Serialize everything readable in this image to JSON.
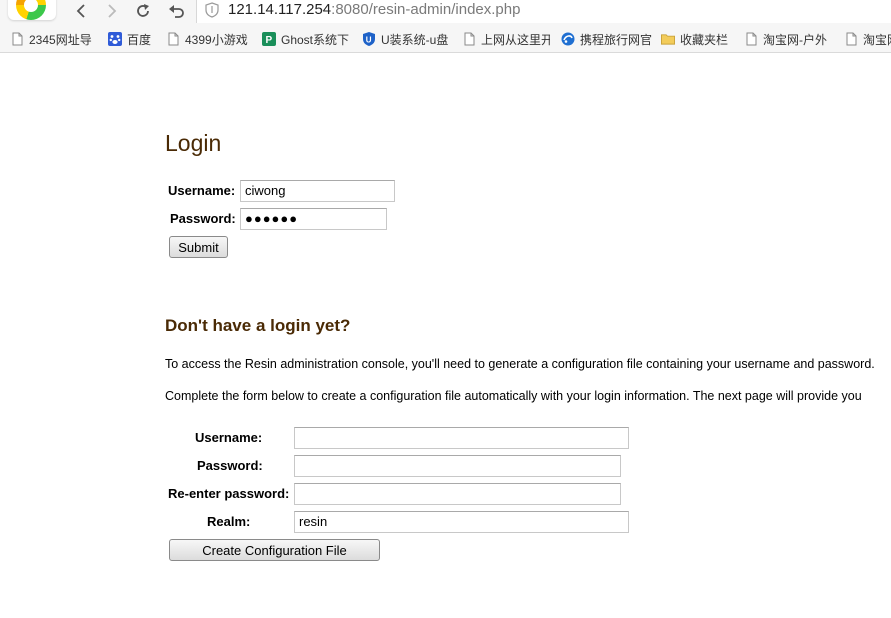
{
  "browser": {
    "url_host": "121.14.117.254",
    "url_rest": ":8080/resin-admin/index.php",
    "bookmarks": [
      {
        "label": "2345网址导",
        "icon": "page-icon"
      },
      {
        "label": "百度",
        "icon": "baidu-paw-icon"
      },
      {
        "label": "4399小游戏",
        "icon": "page-icon"
      },
      {
        "label": "Ghost系统下",
        "icon": "ghost-p-icon"
      },
      {
        "label": "U装系统-u盘",
        "icon": "u-shield-icon"
      },
      {
        "label": "上网从这里开",
        "icon": "page-icon"
      },
      {
        "label": "携程旅行网官",
        "icon": "ctrip-icon"
      },
      {
        "label": "收藏夹栏",
        "icon": "folder-icon"
      },
      {
        "label": "淘宝网-户外",
        "icon": "page-icon"
      },
      {
        "label": "淘宝网",
        "icon": "page-icon"
      }
    ]
  },
  "login": {
    "title": "Login",
    "username_label": "Username:",
    "username_value": "ciwong",
    "password_label": "Password:",
    "password_value": "●●●●●●",
    "submit_label": "Submit"
  },
  "signup": {
    "title": "Don't have a login yet?",
    "para1": "To access the Resin administration console, you'll need to generate a configuration file containing your username and password.",
    "para2": "Complete the form below to create a configuration file automatically with your login information. The next page will provide you",
    "username_label": "Username:",
    "username_value": "",
    "password_label": "Password:",
    "password_value": "",
    "reenter_label": "Re-enter password:",
    "reenter_value": "",
    "realm_label": "Realm:",
    "realm_value": "resin",
    "create_label": "Create Configuration File"
  }
}
